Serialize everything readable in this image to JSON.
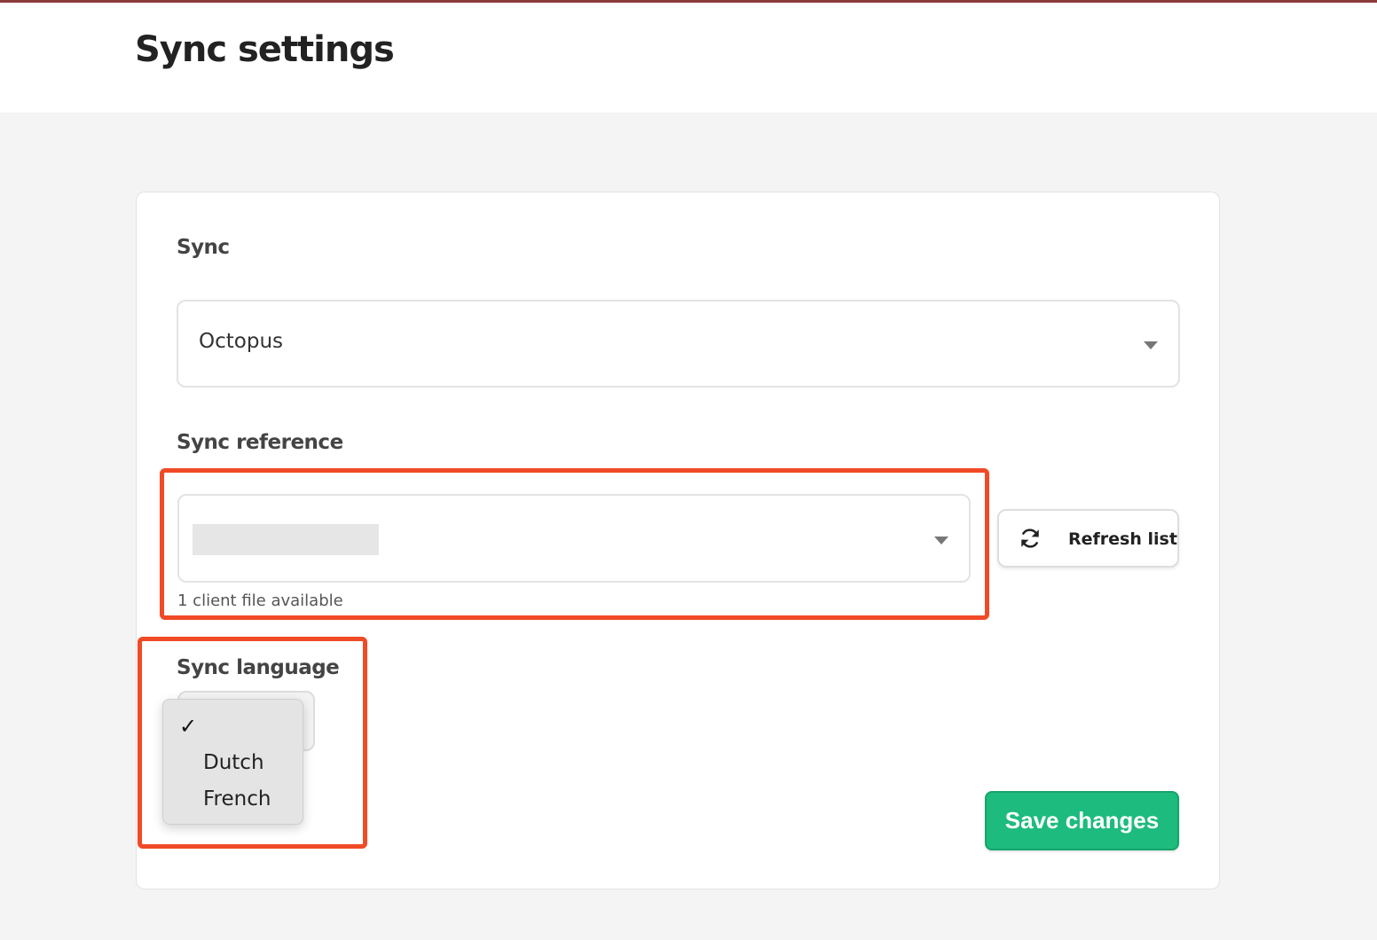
{
  "header": {
    "title": "Sync settings"
  },
  "sync": {
    "label": "Sync",
    "selected": "Octopus"
  },
  "sync_reference": {
    "label": "Sync reference",
    "selected": "",
    "hint": "1 client file available",
    "refresh_label": "Refresh list"
  },
  "sync_language": {
    "label": "Sync language",
    "check_mark": "✓",
    "options": [
      "Dutch",
      "French"
    ]
  },
  "footer": {
    "save_label": "Save changes"
  },
  "colors": {
    "accent": "#1dbb7e",
    "highlight": "#f04a26"
  }
}
